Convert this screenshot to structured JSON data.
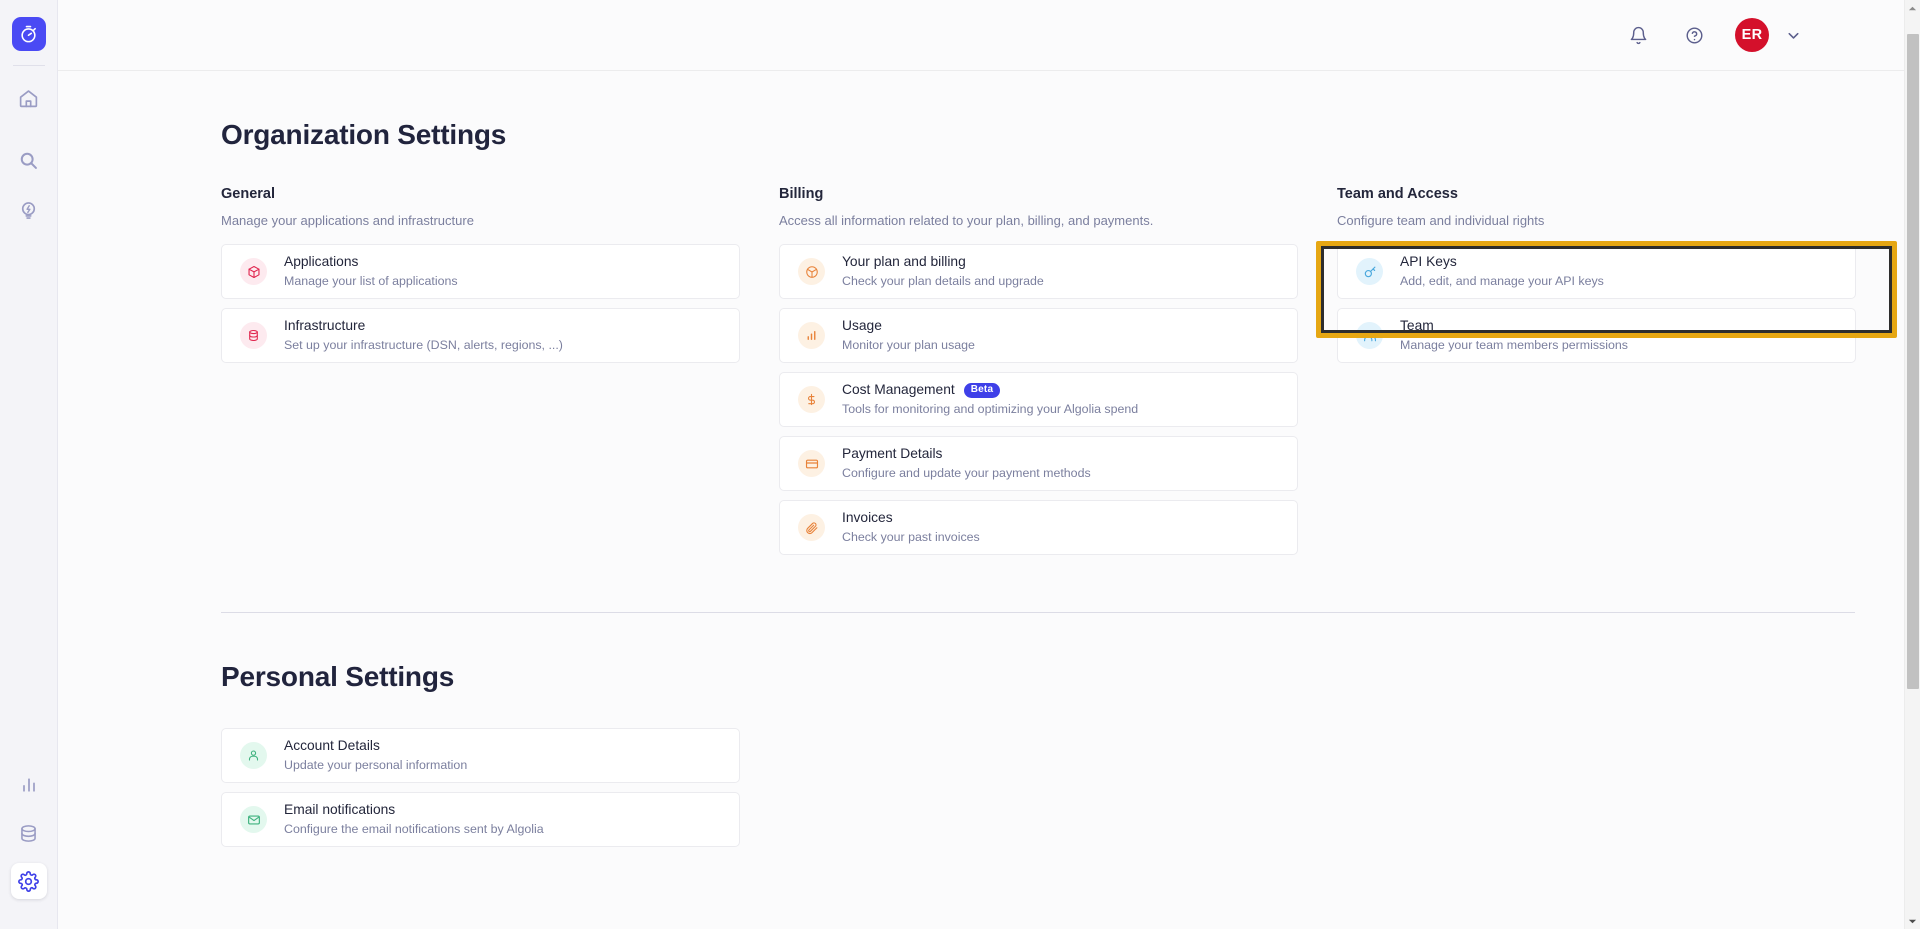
{
  "sidebar": {
    "logo": {
      "name": "algolia-logo",
      "icon": "stopwatch-icon"
    },
    "items": [
      {
        "name": "home",
        "icon": "home-icon"
      },
      {
        "name": "search",
        "icon": "search-icon"
      },
      {
        "name": "accelerate",
        "icon": "lightning-icon"
      }
    ],
    "bottom_items": [
      {
        "name": "analytics",
        "icon": "bar-chart-icon"
      },
      {
        "name": "data-sources",
        "icon": "database-icon"
      },
      {
        "name": "settings",
        "icon": "gear-icon",
        "active": true
      }
    ]
  },
  "topbar": {
    "notifications_icon": "bell-icon",
    "help_icon": "question-circle-icon",
    "avatar_initials": "ER",
    "caret_icon": "chevron-down-icon"
  },
  "organization": {
    "title": "Organization Settings",
    "columns": [
      {
        "key": "general",
        "heading": "General",
        "subheading": "Manage your applications and infrastructure",
        "accent": "#e0254e",
        "cards": [
          {
            "icon": "package-icon",
            "title": "Applications",
            "desc": "Manage your list of applications"
          },
          {
            "icon": "database-icon",
            "title": "Infrastructure",
            "desc": "Set up your infrastructure (DSN, alerts, regions, ...)"
          }
        ]
      },
      {
        "key": "billing",
        "heading": "Billing",
        "subheading": "Access all information related to your plan, billing, and payments.",
        "accent": "#e8833a",
        "cards": [
          {
            "icon": "plan-icon",
            "title": "Your plan and billing",
            "desc": "Check your plan details and upgrade"
          },
          {
            "icon": "bar-chart-icon",
            "title": "Usage",
            "desc": "Monitor your plan usage"
          },
          {
            "icon": "dollar-icon",
            "title": "Cost Management",
            "desc": "Tools for monitoring and optimizing your Algolia spend",
            "badge": "Beta"
          },
          {
            "icon": "credit-card-icon",
            "title": "Payment Details",
            "desc": "Configure and update your payment methods"
          },
          {
            "icon": "paperclip-icon",
            "title": "Invoices",
            "desc": "Check your past invoices"
          }
        ]
      },
      {
        "key": "team_and_access",
        "heading": "Team and Access",
        "subheading": "Configure team and individual rights",
        "accent": "#4aa8dd",
        "cards": [
          {
            "icon": "key-icon",
            "title": "API Keys",
            "desc": "Add, edit, and manage your API keys",
            "highlighted": true
          },
          {
            "icon": "users-icon",
            "title": "Team",
            "desc": "Manage your team members permissions"
          }
        ]
      }
    ]
  },
  "personal": {
    "title": "Personal Settings",
    "accent": "#3fb27f",
    "cards": [
      {
        "icon": "user-icon",
        "title": "Account Details",
        "desc": "Update your personal information"
      },
      {
        "icon": "envelope-icon",
        "title": "Email notifications",
        "desc": "Configure the email notifications sent by Algolia"
      }
    ]
  },
  "highlight_color": "#e6a713"
}
